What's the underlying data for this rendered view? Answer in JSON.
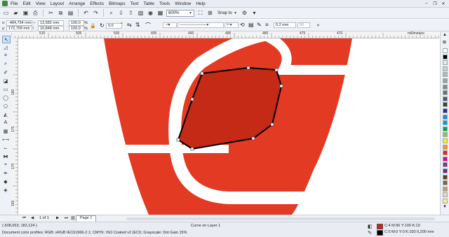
{
  "menu": {
    "items": [
      "File",
      "Edit",
      "View",
      "Layout",
      "Arrange",
      "Effects",
      "Bitmaps",
      "Text",
      "Table",
      "Tools",
      "Window",
      "Help"
    ]
  },
  "toolbar": {
    "zoom": "600%",
    "snap_to": "Snap to"
  },
  "properties": {
    "x": "-484,754 mm",
    "y": "172,709 mm",
    "width": "13,582 mm",
    "height": "10,848 mm",
    "scale_x": "100,0",
    "scale_y": "100,0",
    "percent_sign": "%",
    "rotation": "0,0",
    "outline_width": "0,2 mm",
    "smoothing": "50"
  },
  "ruler": {
    "h_labels": [
      "510",
      "505",
      "500",
      "495",
      "490",
      "485",
      "480",
      "475",
      "470"
    ],
    "v_labels": [
      "180",
      "175",
      "170",
      "165"
    ],
    "unit": "millimeters"
  },
  "page_nav": {
    "count": "1 of 1",
    "tab": "Page 1"
  },
  "status": {
    "coords": "(-508,653; 182,124 )",
    "object": "Curve on Layer 1",
    "profiles": "Document color profiles: RGB: sRGB IEC61966-2.1; CMYK: ISO Coated v2 (ECI); Grayscale: Dot Gain 15%",
    "fill_info": "C:4 M:96 Y:100 K:19",
    "outline_info": "C:0 M:0 Y:0 K:100  0,200 mm",
    "fill_color": "#c8261c",
    "outline_color": "#000000"
  },
  "colors": {
    "logo_red": "#e33a23",
    "selected_fill": "#c42a16"
  },
  "palette": [
    "#ffffff",
    "#000000",
    "#e5e5e5",
    "#d0d0d0",
    "#b8b8b8",
    "#a0a0a0",
    "#888888",
    "#707070",
    "#585858",
    "#404040",
    "#2a2a90",
    "#1e88d6",
    "#00a0e0",
    "#00a651",
    "#8dc63f",
    "#fff200",
    "#f7941d",
    "#ed1c24",
    "#ec008c",
    "#92278f",
    "#662d91",
    "#603913",
    "#8b5e3c",
    "#c69c6d",
    "#f9d2b6",
    "#ffe8a0"
  ]
}
